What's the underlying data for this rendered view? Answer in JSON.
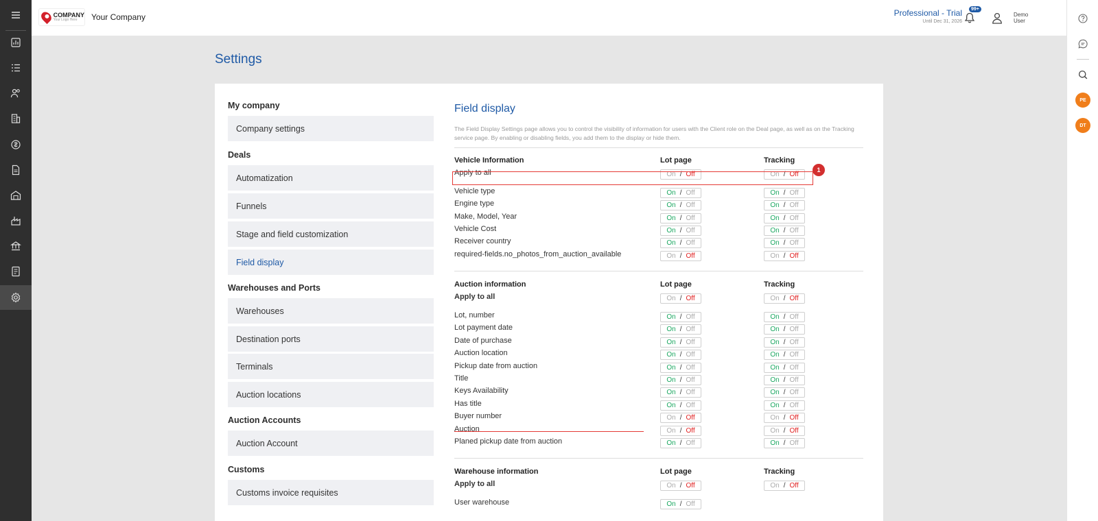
{
  "header": {
    "logo_title": "COMPANY",
    "logo_sub": "Your Logo Here",
    "company_name": "Your Company",
    "plan_name": "Professional - Trial",
    "plan_until": "Until Dec 31, 2026",
    "notifications_badge": "99+",
    "user_name_line1": "Demo",
    "user_name_line2": "User"
  },
  "rail_icons": [
    "menu-icon",
    "dashboard-icon",
    "tasks-icon",
    "contacts-icon",
    "companies-icon",
    "finance-icon",
    "documents-icon",
    "warehouse-icon",
    "factory-icon",
    "port-icon",
    "invoice-icon",
    "settings-icon"
  ],
  "right_panel": {
    "avatars": [
      "PE",
      "DT"
    ]
  },
  "page_title": "Settings",
  "settings_nav": {
    "groups": [
      {
        "title": "My company",
        "items": [
          "Company settings"
        ]
      },
      {
        "title": "Deals",
        "items": [
          "Automatization",
          "Funnels",
          "Stage and field customization",
          "Field display"
        ]
      },
      {
        "title": "Warehouses and Ports",
        "items": [
          "Warehouses",
          "Destination ports",
          "Terminals",
          "Auction locations"
        ]
      },
      {
        "title": "Auction Accounts",
        "items": [
          "Auction Account"
        ]
      },
      {
        "title": "Customs",
        "items": [
          "Customs invoice requisites"
        ]
      }
    ]
  },
  "field_display": {
    "title": "Field display",
    "description": "The Field Display Settings page allows you to control the visibility of information for users with the Client role on the Deal page, as well as on the Tracking service page. By enabling or disabling fields, you add them to the display or hide them.",
    "col_lot": "Lot page",
    "col_tracking": "Tracking",
    "on_label": "On",
    "off_label": "Off",
    "sep": "/",
    "annotation_number": "1",
    "sections": [
      {
        "title": "Vehicle Information",
        "apply_label": "Apply to all",
        "apply": {
          "lot": "off",
          "tracking": "off"
        },
        "rows": [
          {
            "label": "Vehicle type",
            "lot": "on",
            "tracking": "on"
          },
          {
            "label": "Engine type",
            "lot": "on",
            "tracking": "on"
          },
          {
            "label": "Make, Model, Year",
            "lot": "on",
            "tracking": "on"
          },
          {
            "label": "Vehicle Cost",
            "lot": "on",
            "tracking": "on"
          },
          {
            "label": "Receiver country",
            "lot": "on",
            "tracking": "on"
          },
          {
            "label": "required-fields.no_photos_from_auction_available",
            "lot": "off",
            "tracking": "off"
          }
        ]
      },
      {
        "title": "Auction information",
        "apply_label": "Apply to all",
        "apply": {
          "lot": "off",
          "tracking": "off"
        },
        "rows": [
          {
            "label": "Lot, number",
            "lot": "on",
            "tracking": "on"
          },
          {
            "label": "Lot payment date",
            "lot": "on",
            "tracking": "on"
          },
          {
            "label": "Date of purchase",
            "lot": "on",
            "tracking": "on"
          },
          {
            "label": "Auction location",
            "lot": "on",
            "tracking": "on"
          },
          {
            "label": "Pickup date from auction",
            "lot": "on",
            "tracking": "on"
          },
          {
            "label": "Title",
            "lot": "on",
            "tracking": "on"
          },
          {
            "label": "Keys Availability",
            "lot": "on",
            "tracking": "on"
          },
          {
            "label": "Has title",
            "lot": "on",
            "tracking": "on"
          },
          {
            "label": "Buyer number",
            "lot": "off",
            "tracking": "off"
          },
          {
            "label": "Auction",
            "lot": "off",
            "tracking": "off"
          },
          {
            "label": "Planed pickup date from auction",
            "lot": "on",
            "tracking": "on"
          }
        ]
      },
      {
        "title": "Warehouse information",
        "apply_label": "Apply to all",
        "apply": {
          "lot": "off",
          "tracking": "off"
        },
        "rows": [
          {
            "label": "User warehouse",
            "lot": "on",
            "tracking": null
          }
        ]
      }
    ]
  },
  "colors": {
    "accent": "#1f5aa6",
    "on": "#1aa760",
    "off": "#e02020",
    "annotation": "#e53935",
    "avatar": "#f07e1b"
  }
}
